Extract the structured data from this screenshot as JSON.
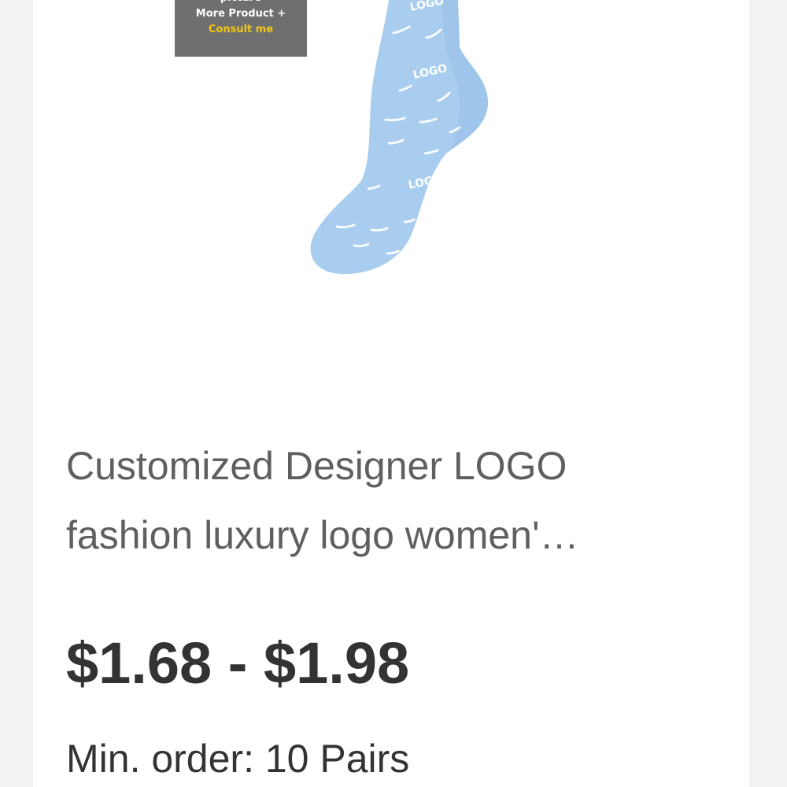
{
  "product": {
    "image": {
      "description_icon": "blue-logo-sock",
      "sock_color": "#a9cdee",
      "sock_logo_text": "LOGO"
    },
    "promo_badge": {
      "line1": "picture",
      "line2": "More Product +",
      "line3": "Consult me"
    },
    "title_line1": "Customized Designer LOGO",
    "title_line2": "fashion luxury logo women'…",
    "price_range": "$1.68 - $1.98",
    "min_order": "Min. order: 10 Pairs"
  }
}
